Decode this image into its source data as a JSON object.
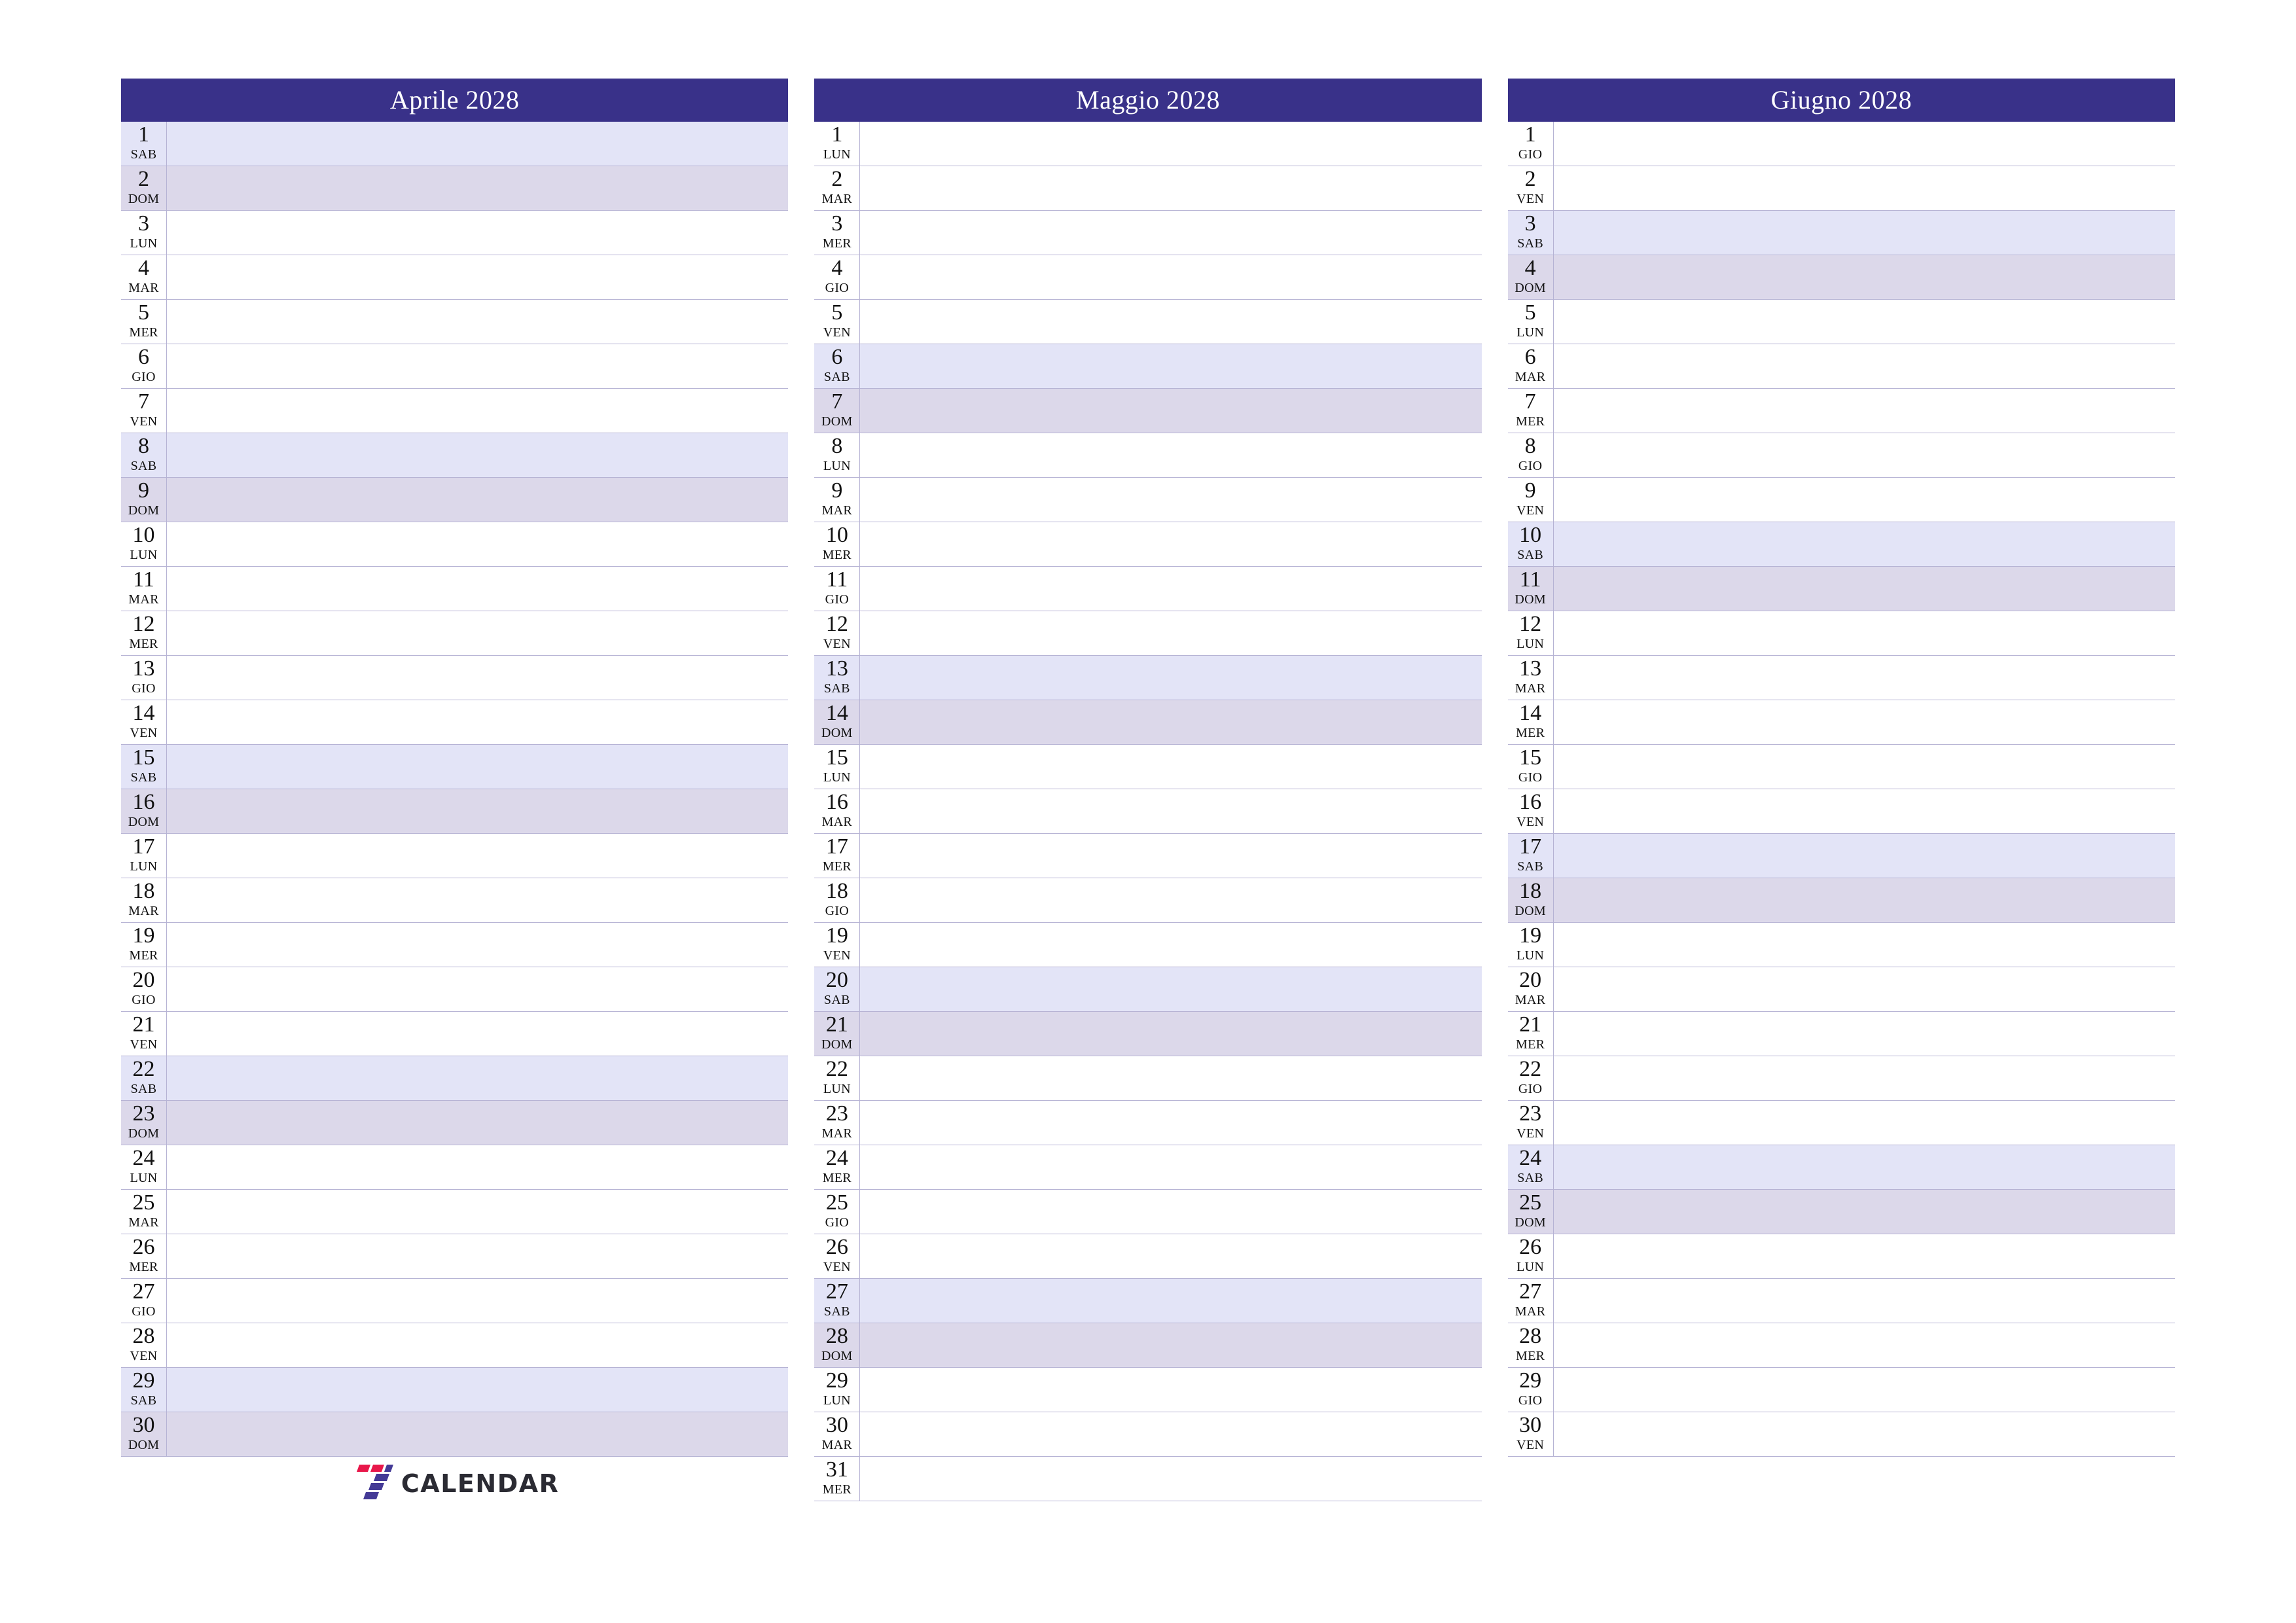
{
  "document": {
    "type": "calendar-planner",
    "orientation": "landscape",
    "language": "it"
  },
  "colors": {
    "header_bg": "#393189",
    "header_text": "#ffffff",
    "saturday_bg": "#e3e4f7",
    "sunday_bg": "#dcd8ea",
    "weekday_bg": "#ffffff",
    "rule": "#b6b3d4",
    "logo_red": "#e8174a",
    "logo_indigo": "#443a96",
    "logo_text": "#2b2b33"
  },
  "months": [
    {
      "title": "Aprile 2028",
      "days": [
        {
          "num": "1",
          "dow": "SAB",
          "type": "sat"
        },
        {
          "num": "2",
          "dow": "DOM",
          "type": "sun"
        },
        {
          "num": "3",
          "dow": "LUN",
          "type": "weekday"
        },
        {
          "num": "4",
          "dow": "MAR",
          "type": "weekday"
        },
        {
          "num": "5",
          "dow": "MER",
          "type": "weekday"
        },
        {
          "num": "6",
          "dow": "GIO",
          "type": "weekday"
        },
        {
          "num": "7",
          "dow": "VEN",
          "type": "weekday"
        },
        {
          "num": "8",
          "dow": "SAB",
          "type": "sat"
        },
        {
          "num": "9",
          "dow": "DOM",
          "type": "sun"
        },
        {
          "num": "10",
          "dow": "LUN",
          "type": "weekday"
        },
        {
          "num": "11",
          "dow": "MAR",
          "type": "weekday"
        },
        {
          "num": "12",
          "dow": "MER",
          "type": "weekday"
        },
        {
          "num": "13",
          "dow": "GIO",
          "type": "weekday"
        },
        {
          "num": "14",
          "dow": "VEN",
          "type": "weekday"
        },
        {
          "num": "15",
          "dow": "SAB",
          "type": "sat"
        },
        {
          "num": "16",
          "dow": "DOM",
          "type": "sun"
        },
        {
          "num": "17",
          "dow": "LUN",
          "type": "weekday"
        },
        {
          "num": "18",
          "dow": "MAR",
          "type": "weekday"
        },
        {
          "num": "19",
          "dow": "MER",
          "type": "weekday"
        },
        {
          "num": "20",
          "dow": "GIO",
          "type": "weekday"
        },
        {
          "num": "21",
          "dow": "VEN",
          "type": "weekday"
        },
        {
          "num": "22",
          "dow": "SAB",
          "type": "sat"
        },
        {
          "num": "23",
          "dow": "DOM",
          "type": "sun"
        },
        {
          "num": "24",
          "dow": "LUN",
          "type": "weekday"
        },
        {
          "num": "25",
          "dow": "MAR",
          "type": "weekday"
        },
        {
          "num": "26",
          "dow": "MER",
          "type": "weekday"
        },
        {
          "num": "27",
          "dow": "GIO",
          "type": "weekday"
        },
        {
          "num": "28",
          "dow": "VEN",
          "type": "weekday"
        },
        {
          "num": "29",
          "dow": "SAB",
          "type": "sat"
        },
        {
          "num": "30",
          "dow": "DOM",
          "type": "sun"
        }
      ]
    },
    {
      "title": "Maggio 2028",
      "days": [
        {
          "num": "1",
          "dow": "LUN",
          "type": "weekday"
        },
        {
          "num": "2",
          "dow": "MAR",
          "type": "weekday"
        },
        {
          "num": "3",
          "dow": "MER",
          "type": "weekday"
        },
        {
          "num": "4",
          "dow": "GIO",
          "type": "weekday"
        },
        {
          "num": "5",
          "dow": "VEN",
          "type": "weekday"
        },
        {
          "num": "6",
          "dow": "SAB",
          "type": "sat"
        },
        {
          "num": "7",
          "dow": "DOM",
          "type": "sun"
        },
        {
          "num": "8",
          "dow": "LUN",
          "type": "weekday"
        },
        {
          "num": "9",
          "dow": "MAR",
          "type": "weekday"
        },
        {
          "num": "10",
          "dow": "MER",
          "type": "weekday"
        },
        {
          "num": "11",
          "dow": "GIO",
          "type": "weekday"
        },
        {
          "num": "12",
          "dow": "VEN",
          "type": "weekday"
        },
        {
          "num": "13",
          "dow": "SAB",
          "type": "sat"
        },
        {
          "num": "14",
          "dow": "DOM",
          "type": "sun"
        },
        {
          "num": "15",
          "dow": "LUN",
          "type": "weekday"
        },
        {
          "num": "16",
          "dow": "MAR",
          "type": "weekday"
        },
        {
          "num": "17",
          "dow": "MER",
          "type": "weekday"
        },
        {
          "num": "18",
          "dow": "GIO",
          "type": "weekday"
        },
        {
          "num": "19",
          "dow": "VEN",
          "type": "weekday"
        },
        {
          "num": "20",
          "dow": "SAB",
          "type": "sat"
        },
        {
          "num": "21",
          "dow": "DOM",
          "type": "sun"
        },
        {
          "num": "22",
          "dow": "LUN",
          "type": "weekday"
        },
        {
          "num": "23",
          "dow": "MAR",
          "type": "weekday"
        },
        {
          "num": "24",
          "dow": "MER",
          "type": "weekday"
        },
        {
          "num": "25",
          "dow": "GIO",
          "type": "weekday"
        },
        {
          "num": "26",
          "dow": "VEN",
          "type": "weekday"
        },
        {
          "num": "27",
          "dow": "SAB",
          "type": "sat"
        },
        {
          "num": "28",
          "dow": "DOM",
          "type": "sun"
        },
        {
          "num": "29",
          "dow": "LUN",
          "type": "weekday"
        },
        {
          "num": "30",
          "dow": "MAR",
          "type": "weekday"
        },
        {
          "num": "31",
          "dow": "MER",
          "type": "weekday"
        }
      ]
    },
    {
      "title": "Giugno 2028",
      "days": [
        {
          "num": "1",
          "dow": "GIO",
          "type": "weekday"
        },
        {
          "num": "2",
          "dow": "VEN",
          "type": "weekday"
        },
        {
          "num": "3",
          "dow": "SAB",
          "type": "sat"
        },
        {
          "num": "4",
          "dow": "DOM",
          "type": "sun"
        },
        {
          "num": "5",
          "dow": "LUN",
          "type": "weekday"
        },
        {
          "num": "6",
          "dow": "MAR",
          "type": "weekday"
        },
        {
          "num": "7",
          "dow": "MER",
          "type": "weekday"
        },
        {
          "num": "8",
          "dow": "GIO",
          "type": "weekday"
        },
        {
          "num": "9",
          "dow": "VEN",
          "type": "weekday"
        },
        {
          "num": "10",
          "dow": "SAB",
          "type": "sat"
        },
        {
          "num": "11",
          "dow": "DOM",
          "type": "sun"
        },
        {
          "num": "12",
          "dow": "LUN",
          "type": "weekday"
        },
        {
          "num": "13",
          "dow": "MAR",
          "type": "weekday"
        },
        {
          "num": "14",
          "dow": "MER",
          "type": "weekday"
        },
        {
          "num": "15",
          "dow": "GIO",
          "type": "weekday"
        },
        {
          "num": "16",
          "dow": "VEN",
          "type": "weekday"
        },
        {
          "num": "17",
          "dow": "SAB",
          "type": "sat"
        },
        {
          "num": "18",
          "dow": "DOM",
          "type": "sun"
        },
        {
          "num": "19",
          "dow": "LUN",
          "type": "weekday"
        },
        {
          "num": "20",
          "dow": "MAR",
          "type": "weekday"
        },
        {
          "num": "21",
          "dow": "MER",
          "type": "weekday"
        },
        {
          "num": "22",
          "dow": "GIO",
          "type": "weekday"
        },
        {
          "num": "23",
          "dow": "VEN",
          "type": "weekday"
        },
        {
          "num": "24",
          "dow": "SAB",
          "type": "sat"
        },
        {
          "num": "25",
          "dow": "DOM",
          "type": "sun"
        },
        {
          "num": "26",
          "dow": "LUN",
          "type": "weekday"
        },
        {
          "num": "27",
          "dow": "MAR",
          "type": "weekday"
        },
        {
          "num": "28",
          "dow": "MER",
          "type": "weekday"
        },
        {
          "num": "29",
          "dow": "GIO",
          "type": "weekday"
        },
        {
          "num": "30",
          "dow": "VEN",
          "type": "weekday"
        }
      ]
    }
  ],
  "footer": {
    "logo_text": "CALENDAR",
    "logo_mark": "seven-blocks-logo"
  }
}
